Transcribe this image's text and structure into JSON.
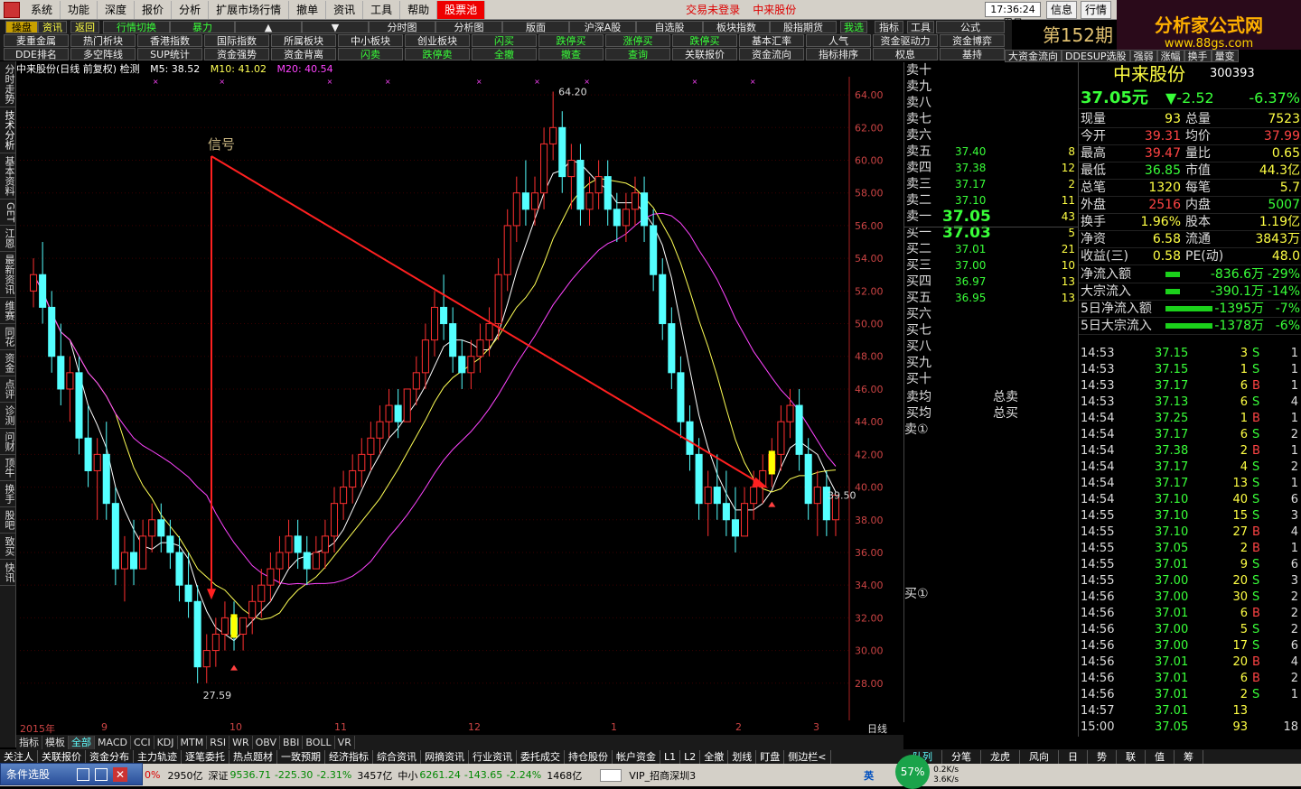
{
  "menu": {
    "items": [
      "系统",
      "功能",
      "深度",
      "报价",
      "分析",
      "扩展市场行情",
      "撤单",
      "资讯",
      "工具",
      "帮助"
    ],
    "active": "股票池",
    "notice1": "交易未登录",
    "notice2": "中来股份",
    "clock": "17:36:24 周日",
    "info_btn": "信息",
    "quote_btn": "行情"
  },
  "brand": {
    "name": "分析家公式网",
    "url": "www.88gs.com"
  },
  "toolbar": {
    "row1": [
      "操盘",
      "资讯",
      "返回",
      "行情切换",
      "暴力",
      "▲",
      "▼",
      "分时图",
      "分析图",
      "版面",
      "沪深A股",
      "自选股",
      "板块指数",
      "股指期货",
      "我选",
      "指标",
      "工具",
      "公式"
    ],
    "row2": [
      "麦重金属",
      "热门析块",
      "香港指数",
      "国际指数",
      "所属板块",
      "中小板块",
      "创业板块",
      "闪买",
      "跌停买",
      "涨停买",
      "跌停买",
      "基本汇率",
      "人气",
      "资金驱动力",
      "资金博弈"
    ],
    "row3": [
      "DDE排名",
      "多空阵线",
      "SUP统计",
      "资金强势",
      "资金背离",
      "闪卖",
      "跌停卖",
      "全撤",
      "撤查",
      "查询",
      "关联报价",
      "资金流向",
      "指标排序",
      "权息",
      "基持"
    ],
    "right_title": "第152期",
    "right_row": [
      "大资金流向",
      "DDESUP选股",
      "强弱",
      "涨幅",
      "换手",
      "量变"
    ]
  },
  "sidebar": [
    "分时走势",
    "技术分析",
    "基本资料",
    "GET",
    "江恩",
    "最新资讯",
    "维赛",
    "同花",
    "资金",
    "点评",
    "诊测",
    "问财",
    "顶牛",
    "换手",
    "股吧",
    "致买",
    "快讯"
  ],
  "chart": {
    "header": "中来股份(日线 前复权) 检测",
    "ma5_label": "M5: 38.52",
    "ma10_label": "M10: 41.02",
    "ma20_label": "M20: 40.54",
    "annotation": "信号",
    "high_label": "64.20",
    "low_label": "27.59",
    "last_label": "39.50",
    "x_labels": [
      "2015年",
      "9",
      "10",
      "11",
      "12",
      "1",
      "2",
      "3"
    ],
    "period": "日线"
  },
  "chart_data": {
    "type": "candlestick",
    "title": "中来股份(日线 前复权)",
    "ylim": [
      26,
      65
    ],
    "yticks": [
      28,
      30,
      32,
      34,
      36,
      38,
      40,
      42,
      44,
      46,
      48,
      50,
      52,
      54,
      56,
      58,
      60,
      62,
      64
    ],
    "x_months": [
      "2015年",
      "9",
      "10",
      "11",
      "12",
      "1",
      "2",
      "3"
    ],
    "max_price": 64.2,
    "min_price": 27.59,
    "last_price": 39.5,
    "ma": {
      "M5": 38.52,
      "M10": 41.02,
      "M20": 40.54
    },
    "candles": [
      [
        52,
        54,
        51,
        53
      ],
      [
        53,
        55,
        50,
        51
      ],
      [
        51,
        52,
        47,
        48
      ],
      [
        48,
        50,
        45,
        46
      ],
      [
        46,
        48,
        44,
        47
      ],
      [
        47,
        48,
        42,
        43
      ],
      [
        43,
        45,
        40,
        41
      ],
      [
        41,
        43,
        38,
        42
      ],
      [
        42,
        44,
        38,
        39
      ],
      [
        39,
        40,
        34,
        35
      ],
      [
        35,
        37,
        33,
        36
      ],
      [
        36,
        38,
        34,
        35
      ],
      [
        35,
        38,
        35,
        37
      ],
      [
        37,
        39,
        36,
        38
      ],
      [
        38,
        39,
        36,
        37
      ],
      [
        37,
        38,
        35,
        36
      ],
      [
        36,
        37,
        33,
        34
      ],
      [
        34,
        36,
        32,
        33
      ],
      [
        33,
        34,
        28,
        29
      ],
      [
        29,
        31,
        28,
        30
      ],
      [
        30,
        32,
        29,
        31
      ],
      [
        31,
        33,
        30,
        32
      ],
      [
        32,
        33,
        30,
        31
      ],
      [
        31,
        32,
        30,
        32
      ],
      [
        32,
        34,
        31,
        33
      ],
      [
        33,
        35,
        32,
        34
      ],
      [
        34,
        36,
        33,
        35
      ],
      [
        35,
        37,
        34,
        36
      ],
      [
        36,
        38,
        35,
        37
      ],
      [
        37,
        38,
        35,
        36
      ],
      [
        36,
        37,
        34,
        35
      ],
      [
        35,
        37,
        35,
        36
      ],
      [
        36,
        38,
        35,
        37
      ],
      [
        37,
        40,
        36,
        39
      ],
      [
        39,
        41,
        38,
        40
      ],
      [
        40,
        42,
        39,
        41
      ],
      [
        41,
        43,
        40,
        42
      ],
      [
        42,
        44,
        41,
        43
      ],
      [
        43,
        45,
        42,
        44
      ],
      [
        44,
        46,
        43,
        45
      ],
      [
        45,
        46,
        43,
        44
      ],
      [
        44,
        46,
        44,
        46
      ],
      [
        46,
        48,
        45,
        47
      ],
      [
        47,
        50,
        46,
        49
      ],
      [
        49,
        52,
        48,
        51
      ],
      [
        51,
        53,
        49,
        50
      ],
      [
        50,
        51,
        47,
        48
      ],
      [
        48,
        49,
        46,
        47
      ],
      [
        47,
        49,
        46,
        48
      ],
      [
        48,
        50,
        47,
        49
      ],
      [
        49,
        51,
        48,
        50
      ],
      [
        50,
        54,
        49,
        53
      ],
      [
        53,
        57,
        52,
        56
      ],
      [
        56,
        59,
        55,
        58
      ],
      [
        58,
        60,
        56,
        57
      ],
      [
        57,
        59,
        56,
        58
      ],
      [
        58,
        62,
        57,
        61
      ],
      [
        61,
        64.2,
        60,
        62
      ],
      [
        62,
        63,
        58,
        59
      ],
      [
        59,
        61,
        57,
        60
      ],
      [
        60,
        61,
        56,
        57
      ],
      [
        57,
        59,
        56,
        58
      ],
      [
        58,
        60,
        57,
        59
      ],
      [
        59,
        60,
        56,
        57
      ],
      [
        57,
        58,
        55,
        56
      ],
      [
        56,
        58,
        55,
        57
      ],
      [
        57,
        59,
        56,
        58
      ],
      [
        58,
        59,
        55,
        56
      ],
      [
        56,
        57,
        52,
        53
      ],
      [
        53,
        54,
        49,
        50
      ],
      [
        50,
        51,
        46,
        47
      ],
      [
        47,
        48,
        43,
        44
      ],
      [
        44,
        45,
        41,
        42
      ],
      [
        42,
        43,
        38,
        39
      ],
      [
        39,
        41,
        37,
        40
      ],
      [
        40,
        42,
        38,
        39
      ],
      [
        39,
        41,
        37,
        38
      ],
      [
        38,
        40,
        36,
        37
      ],
      [
        37,
        40,
        37,
        39
      ],
      [
        39,
        41,
        38,
        40
      ],
      [
        40,
        42,
        39,
        41
      ],
      [
        41,
        43,
        40,
        42
      ],
      [
        42,
        45,
        41,
        44
      ],
      [
        44,
        46,
        43,
        45
      ],
      [
        45,
        46,
        41,
        42
      ],
      [
        42,
        43,
        38,
        39
      ],
      [
        39,
        41,
        37,
        40
      ],
      [
        40,
        41,
        37,
        38
      ],
      [
        38,
        39.5,
        37,
        39.5
      ]
    ]
  },
  "orderbook": {
    "sell_labels": [
      "卖十",
      "卖九",
      "卖八",
      "卖七",
      "卖六",
      "卖五",
      "卖四",
      "卖三",
      "卖二",
      "卖一"
    ],
    "buy_labels": [
      "买一",
      "买二",
      "买三",
      "买四",
      "买五",
      "买六",
      "买七",
      "买八",
      "买九",
      "买十"
    ],
    "sell_prices": [
      "",
      "",
      "",
      "",
      "",
      "37.40",
      "37.38",
      "37.17",
      "37.10",
      "37.05"
    ],
    "sell_vols": [
      "",
      "",
      "",
      "",
      "",
      "8",
      "12",
      "2",
      "11",
      "43"
    ],
    "buy_prices": [
      "37.03",
      "37.01",
      "37.00",
      "36.97",
      "36.95",
      "",
      "",
      "",
      "",
      ""
    ],
    "buy_vols": [
      "5",
      "21",
      "10",
      "13",
      "13",
      "",
      "",
      "",
      "",
      ""
    ],
    "avg_sell": "卖均",
    "avg_buy": "买均",
    "total_sell": "总卖",
    "total_buy": "总买",
    "sell1": "卖①",
    "buy1": "买①"
  },
  "quote": {
    "name": "中来股份",
    "code": "300393",
    "price": "37.05元",
    "change": "▼-2.52",
    "pct": "-6.37%",
    "rows": [
      [
        "现量",
        "93",
        "总量",
        "7523"
      ],
      [
        "今开",
        "39.31",
        "均价",
        "37.99"
      ],
      [
        "最高",
        "39.47",
        "量比",
        "0.65"
      ],
      [
        "最低",
        "36.85",
        "市值",
        "44.3亿"
      ],
      [
        "总笔",
        "1320",
        "每笔",
        "5.7"
      ],
      [
        "外盘",
        "2516",
        "内盘",
        "5007"
      ],
      [
        "换手",
        "1.96%",
        "股本",
        "1.19亿"
      ],
      [
        "净资",
        "6.58",
        "流通",
        "3843万"
      ],
      [
        "收益(三)",
        "0.58",
        "PE(动)",
        "48.0"
      ]
    ],
    "flow": [
      [
        "净流入额",
        "-836.6万",
        "-29%"
      ],
      [
        "大宗流入",
        "-390.1万",
        "-14%"
      ],
      [
        "5日净流入额",
        "-1395万",
        "-7%"
      ],
      [
        "5日大宗流入",
        "-1378万",
        "-6%"
      ]
    ]
  },
  "ticks": [
    [
      "14:53",
      "37.15",
      "3",
      "S",
      "1"
    ],
    [
      "14:53",
      "37.15",
      "1",
      "S",
      "1"
    ],
    [
      "14:53",
      "37.17",
      "6",
      "B",
      "1"
    ],
    [
      "14:53",
      "37.13",
      "6",
      "S",
      "4"
    ],
    [
      "14:54",
      "37.25",
      "1",
      "B",
      "1"
    ],
    [
      "14:54",
      "37.17",
      "6",
      "S",
      "2"
    ],
    [
      "14:54",
      "37.38",
      "2",
      "B",
      "1"
    ],
    [
      "14:54",
      "37.17",
      "4",
      "S",
      "2"
    ],
    [
      "14:54",
      "37.17",
      "13",
      "S",
      "1"
    ],
    [
      "14:54",
      "37.10",
      "40",
      "S",
      "6"
    ],
    [
      "14:55",
      "37.10",
      "15",
      "S",
      "3"
    ],
    [
      "14:55",
      "37.10",
      "27",
      "B",
      "4"
    ],
    [
      "14:55",
      "37.05",
      "2",
      "B",
      "1"
    ],
    [
      "14:55",
      "37.01",
      "9",
      "S",
      "6"
    ],
    [
      "14:55",
      "37.00",
      "20",
      "S",
      "3"
    ],
    [
      "14:56",
      "37.00",
      "30",
      "S",
      "2"
    ],
    [
      "14:56",
      "37.01",
      "6",
      "B",
      "2"
    ],
    [
      "14:56",
      "37.00",
      "5",
      "S",
      "2"
    ],
    [
      "14:56",
      "37.00",
      "17",
      "S",
      "6"
    ],
    [
      "14:56",
      "37.01",
      "20",
      "B",
      "4"
    ],
    [
      "14:56",
      "37.01",
      "6",
      "B",
      "2"
    ],
    [
      "14:56",
      "37.01",
      "2",
      "S",
      "1"
    ],
    [
      "14:57",
      "37.01",
      "13",
      "",
      ""
    ],
    [
      "15:00",
      "37.05",
      "93",
      "",
      "18"
    ]
  ],
  "tabs": [
    "指标",
    "模板",
    "全部",
    "MACD",
    "CCI",
    "KDJ",
    "MTM",
    "RSI",
    "WR",
    "OBV",
    "BBI",
    "BOLL",
    "VR"
  ],
  "funcbar": [
    "关注人",
    "关联报价",
    "资金分布",
    "主力轨迹",
    "逐笔委托",
    "热点题材",
    "一致预期",
    "经济指标",
    "综合资讯",
    "网摘资讯",
    "行业资讯",
    "委托成交",
    "持仓股份",
    "帐户资金",
    "L1",
    "L2",
    "全撤",
    "划线",
    "盯盘",
    "侧边栏<"
  ],
  "quote_tabs": [
    "队列",
    "分笔",
    "龙虎",
    "风向",
    "日",
    "势",
    "联",
    "值",
    "筹"
  ],
  "status": {
    "sel_btn": "条件选股",
    "pct_red": "0%",
    "amt1": "2950亿",
    "sz_label": "深证",
    "sz_val": "9536.71",
    "sz_chg": "-225.30",
    "sz_pct": "-2.31%",
    "amt2": "3457亿",
    "zx_label": "中小",
    "zx_val": "6261.24",
    "zx_chg": "-143.65",
    "zx_pct": "-2.24%",
    "amt3": "1468亿",
    "vip": "VIP_招商深圳3",
    "ime": "英",
    "cpu": "57%",
    "net_up": "0.2K/s",
    "net_down": "3.6K/s"
  }
}
